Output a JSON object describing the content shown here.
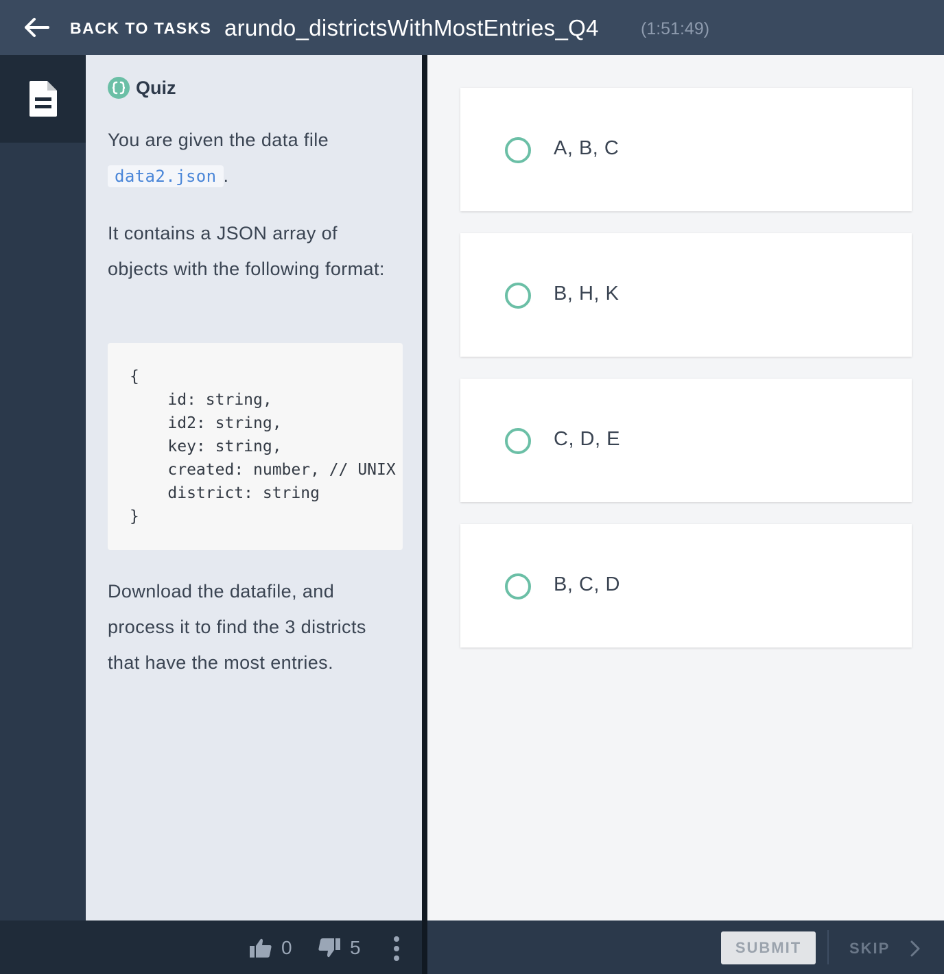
{
  "header": {
    "back_label": "BACK TO TASKS",
    "task_title": "arundo_districtsWithMostEntries_Q4",
    "timer": "(1:51:49)"
  },
  "rail": {
    "items": [
      {
        "icon": "document-icon",
        "active": true
      }
    ]
  },
  "instructions": {
    "heading": "Quiz",
    "p1_before": "You are given the data file",
    "file_name": "data2.json",
    "p1_after": ".",
    "p2": "It contains a JSON array of objects with the following format:",
    "code": "{\n    id: string,\n    id2: string,\n    key: string,\n    created: number, // UNIX timestamp\n    district: string\n}",
    "p3": "Download the datafile, and process it to find the 3 districts that have the most entries."
  },
  "options": [
    {
      "label": "A, B, C"
    },
    {
      "label": "B, H, K"
    },
    {
      "label": "C, D, E"
    },
    {
      "label": "B, C, D"
    }
  ],
  "footer": {
    "upvotes": "0",
    "downvotes": "5",
    "submit_label": "SUBMIT",
    "skip_label": "SKIP"
  },
  "colors": {
    "header_bg": "#3a4a5f",
    "accent_green": "#6bbfa6",
    "link_blue": "#4a86d8"
  }
}
